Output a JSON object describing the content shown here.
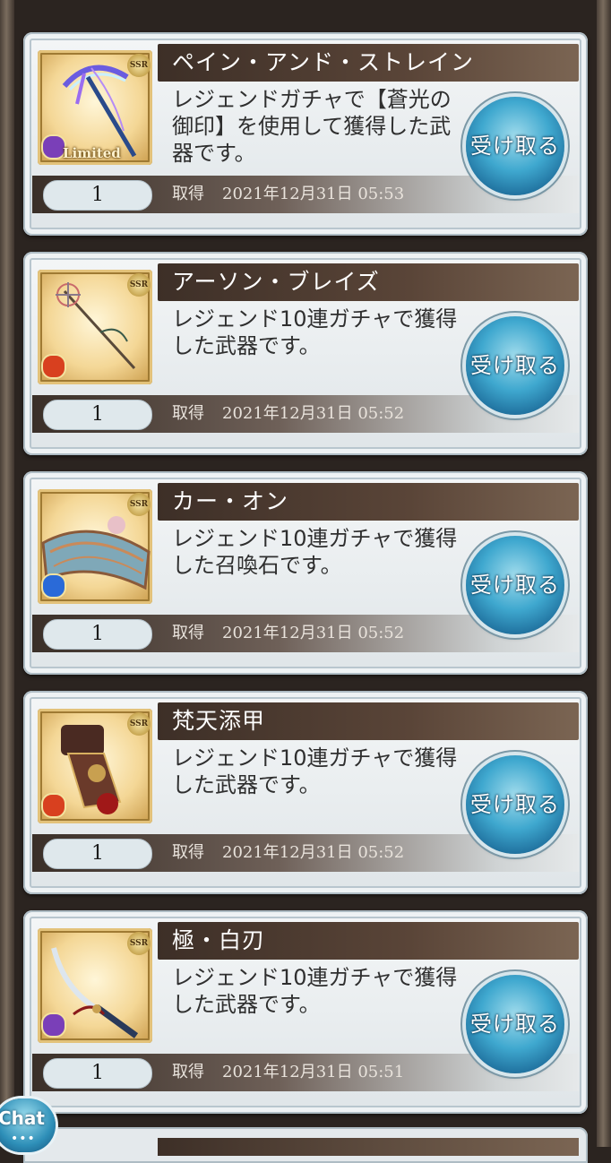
{
  "items": [
    {
      "name": "ペイン・アンド・ストレイン",
      "description": "レジェンドガチャで【蒼光の御印】を使用して獲得した武器です。",
      "quantity": "1",
      "acquired_label": "取得",
      "acquired_date": "2021年12月31日 05:53",
      "rarity": "SSR",
      "badge": "Limited",
      "element_color": "#7a3fb8",
      "icon": "scythe-icon",
      "claim_label": "受け取る"
    },
    {
      "name": "アーソン・ブレイズ",
      "description": "レジェンド10連ガチャで獲得した武器です。",
      "quantity": "1",
      "acquired_label": "取得",
      "acquired_date": "2021年12月31日 05:52",
      "rarity": "SSR",
      "element_color": "#d8401f",
      "icon": "staff-icon",
      "claim_label": "受け取る"
    },
    {
      "name": "カー・オン",
      "description": "レジェンド10連ガチャで獲得した召喚石です。",
      "quantity": "1",
      "acquired_label": "取得",
      "acquired_date": "2021年12月31日 05:52",
      "rarity": "SSR",
      "element_color": "#2a6ad8",
      "icon": "summon-stone-icon",
      "claim_label": "受け取る"
    },
    {
      "name": "梵天添甲",
      "description": "レジェンド10連ガチャで獲得した武器です。",
      "quantity": "1",
      "acquired_label": "取得",
      "acquired_date": "2021年12月31日 05:52",
      "rarity": "SSR",
      "element_color": "#d8401f",
      "icon": "gauntlet-icon",
      "claim_label": "受け取る"
    },
    {
      "name": "極・白刃",
      "description": "レジェンド10連ガチャで獲得した武器です。",
      "quantity": "1",
      "acquired_label": "取得",
      "acquired_date": "2021年12月31日 05:51",
      "rarity": "SSR",
      "element_color": "#7a3fb8",
      "icon": "katana-icon",
      "claim_label": "受け取る"
    }
  ],
  "chat": {
    "label": "Chat",
    "dots": "•••"
  }
}
